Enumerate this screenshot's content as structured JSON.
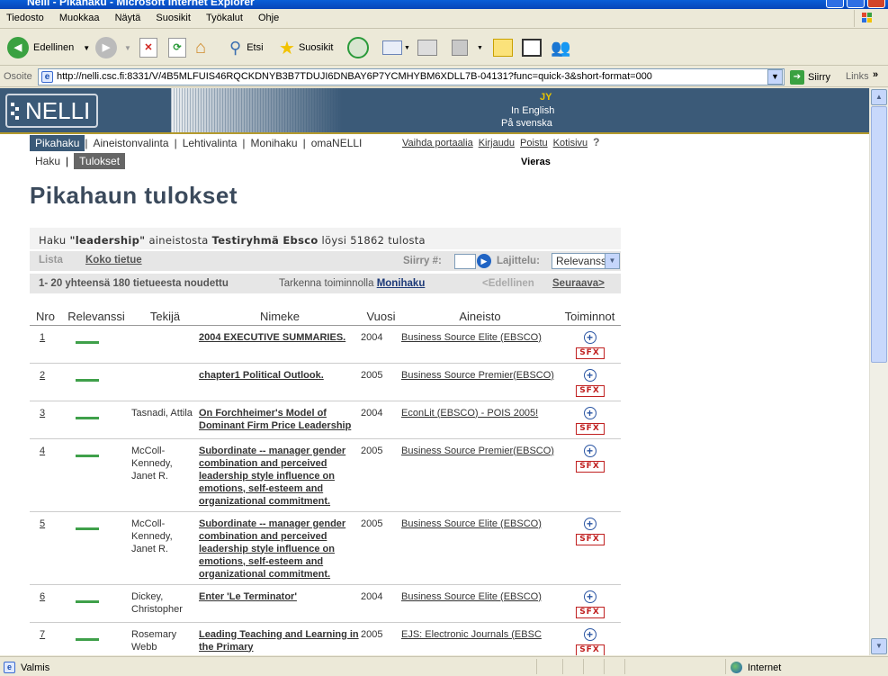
{
  "window": {
    "title": "Nelli - Pikahaku - Microsoft Internet Explorer"
  },
  "menu": [
    "Tiedosto",
    "Muokkaa",
    "Näytä",
    "Suosikit",
    "Työkalut",
    "Ohje"
  ],
  "toolbar": {
    "back": "Edellinen",
    "search": "Etsi",
    "favorites": "Suosikit"
  },
  "address": {
    "label": "Osoite",
    "url": "http://nelli.csc.fi:8331/V/4B5MLFUIS46RQCKDNYB3B7TDUJI6DNBAY6P7YCMHYBM6XDLL7B-04131?func=quick-3&short-format=000",
    "go": "Siirry",
    "links": "Links"
  },
  "banner": {
    "logo": "NELLI",
    "user": "JY",
    "english": "In English",
    "swedish": "På svenska"
  },
  "nav": {
    "main": [
      "Pikahaku",
      "Aineistonvalinta",
      "Lehtivalinta",
      "Monihaku",
      "omaNELLI"
    ],
    "right": [
      "Vaihda portaalia",
      "Kirjaudu",
      "Poistu",
      "Kotisivu"
    ],
    "sub": [
      "Haku",
      "Tulokset"
    ],
    "guest": "Vieras"
  },
  "page": {
    "title": "Pikahaun tulokset"
  },
  "summary": {
    "prefix": "Haku",
    "term": "\"leadership\"",
    "mid": "aineistosta",
    "db": "Testiryhmä Ebsco",
    "suffix": "löysi 51862 tulosta"
  },
  "controls": {
    "list": "Lista",
    "full": "Koko tietue",
    "jump": "Siirry #:",
    "sort": "Lajittelu:",
    "sort_value": "Relevanssi"
  },
  "range": {
    "text": "1- 20 yhteensä 180 tietueesta noudettu",
    "refine": "Tarkenna toiminnolla",
    "refine_link": "Monihaku",
    "prev": "<Edellinen",
    "next": "Seuraava>"
  },
  "table": {
    "headers": [
      "Nro",
      "Relevanssi",
      "Tekijä",
      "Nimeke",
      "Vuosi",
      "Aineisto",
      "Toiminnot"
    ],
    "rows": [
      {
        "nro": "1",
        "author": "",
        "title": "2004 EXECUTIVE SUMMARIES.",
        "year": "2004",
        "source": "Business Source Elite (EBSCO)"
      },
      {
        "nro": "2",
        "author": "",
        "title": "chapter1 Political Outlook.",
        "year": "2005",
        "source": "Business Source Premier(EBSCO)"
      },
      {
        "nro": "3",
        "author": "Tasnadi, Attila",
        "title": "On Forchheimer's Model of Dominant Firm Price Leadership",
        "year": "2004",
        "source": "EconLit (EBSCO) - POIS 2005!"
      },
      {
        "nro": "4",
        "author": "McColl-Kennedy, Janet R.",
        "title": "Subordinate -- manager gender combination and perceived leadership style influence on emotions, self-esteem and organizational commitment.",
        "year": "2005",
        "source": "Business Source Premier(EBSCO)"
      },
      {
        "nro": "5",
        "author": "McColl-Kennedy, Janet R.",
        "title": "Subordinate -- manager gender combination and perceived leadership style influence on emotions, self-esteem and organizational commitment.",
        "year": "2005",
        "source": "Business Source Elite (EBSCO)"
      },
      {
        "nro": "6",
        "author": "Dickey, Christopher",
        "title": "Enter 'Le Terminator'",
        "year": "2004",
        "source": "Business Source Elite (EBSCO)"
      },
      {
        "nro": "7",
        "author": "Rosemary Webb",
        "title": "Leading Teaching and Learning in the Primary",
        "year": "2005",
        "source": "EJS: Electronic Journals (EBSC"
      }
    ],
    "sfx": "SFX"
  },
  "status": {
    "text": "Valmis",
    "zone": "Internet"
  }
}
